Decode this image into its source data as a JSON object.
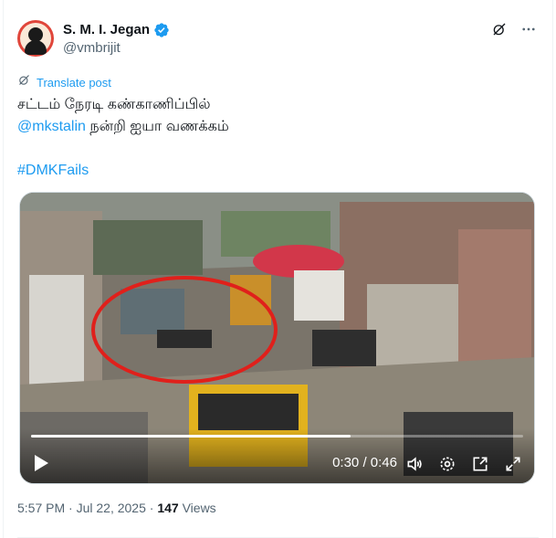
{
  "author": {
    "display_name": "S. M. I. Jegan",
    "handle": "@vmbrijit",
    "verified": true
  },
  "header_icons": [
    "grok-icon",
    "more-icon"
  ],
  "translate_label": "Translate post",
  "tweet": {
    "line1": "சட்டம் நேரடி கண்காணிப்பில்",
    "mention": "@mkstalin",
    "line2_rest": " நன்றி ஐயா வணக்கம்",
    "hashtag": "#DMKFails"
  },
  "video": {
    "current_time": "0:30",
    "separator": " / ",
    "duration": "0:46",
    "progress": 0.65,
    "controls": [
      "play-icon",
      "volume-icon",
      "settings-icon",
      "pip-icon",
      "fullscreen-icon"
    ]
  },
  "meta": {
    "time": "5:57 PM",
    "dot": " · ",
    "date": "Jul 22, 2025",
    "views_count": "147",
    "views_label": " Views"
  },
  "colors": {
    "accent": "#1d9bf0",
    "text": "#0f1419",
    "secondary": "#536471",
    "annotation_circle": "#e0201b"
  }
}
